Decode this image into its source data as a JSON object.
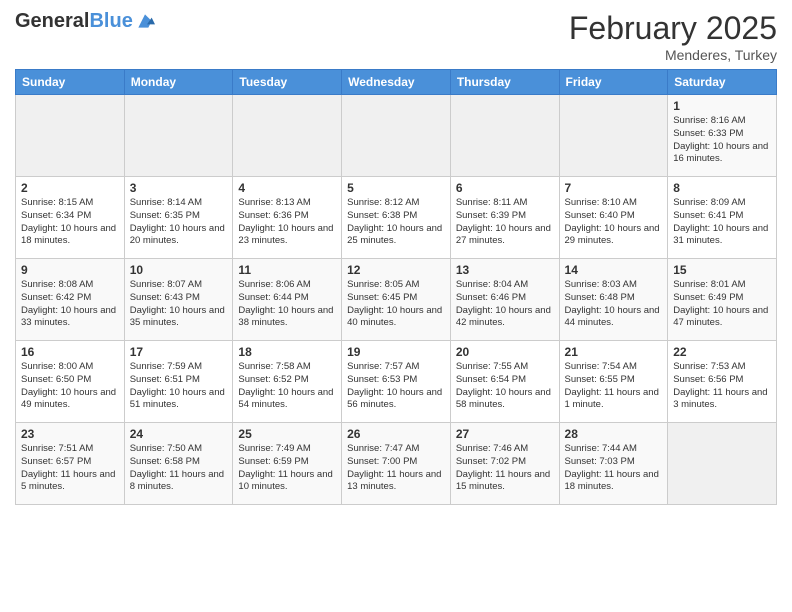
{
  "header": {
    "logo_general": "General",
    "logo_blue": "Blue",
    "month_title": "February 2025",
    "subtitle": "Menderes, Turkey"
  },
  "days_of_week": [
    "Sunday",
    "Monday",
    "Tuesday",
    "Wednesday",
    "Thursday",
    "Friday",
    "Saturday"
  ],
  "weeks": [
    [
      {
        "day": "",
        "info": ""
      },
      {
        "day": "",
        "info": ""
      },
      {
        "day": "",
        "info": ""
      },
      {
        "day": "",
        "info": ""
      },
      {
        "day": "",
        "info": ""
      },
      {
        "day": "",
        "info": ""
      },
      {
        "day": "1",
        "info": "Sunrise: 8:16 AM\nSunset: 6:33 PM\nDaylight: 10 hours and 16 minutes."
      }
    ],
    [
      {
        "day": "2",
        "info": "Sunrise: 8:15 AM\nSunset: 6:34 PM\nDaylight: 10 hours and 18 minutes."
      },
      {
        "day": "3",
        "info": "Sunrise: 8:14 AM\nSunset: 6:35 PM\nDaylight: 10 hours and 20 minutes."
      },
      {
        "day": "4",
        "info": "Sunrise: 8:13 AM\nSunset: 6:36 PM\nDaylight: 10 hours and 23 minutes."
      },
      {
        "day": "5",
        "info": "Sunrise: 8:12 AM\nSunset: 6:38 PM\nDaylight: 10 hours and 25 minutes."
      },
      {
        "day": "6",
        "info": "Sunrise: 8:11 AM\nSunset: 6:39 PM\nDaylight: 10 hours and 27 minutes."
      },
      {
        "day": "7",
        "info": "Sunrise: 8:10 AM\nSunset: 6:40 PM\nDaylight: 10 hours and 29 minutes."
      },
      {
        "day": "8",
        "info": "Sunrise: 8:09 AM\nSunset: 6:41 PM\nDaylight: 10 hours and 31 minutes."
      }
    ],
    [
      {
        "day": "9",
        "info": "Sunrise: 8:08 AM\nSunset: 6:42 PM\nDaylight: 10 hours and 33 minutes."
      },
      {
        "day": "10",
        "info": "Sunrise: 8:07 AM\nSunset: 6:43 PM\nDaylight: 10 hours and 35 minutes."
      },
      {
        "day": "11",
        "info": "Sunrise: 8:06 AM\nSunset: 6:44 PM\nDaylight: 10 hours and 38 minutes."
      },
      {
        "day": "12",
        "info": "Sunrise: 8:05 AM\nSunset: 6:45 PM\nDaylight: 10 hours and 40 minutes."
      },
      {
        "day": "13",
        "info": "Sunrise: 8:04 AM\nSunset: 6:46 PM\nDaylight: 10 hours and 42 minutes."
      },
      {
        "day": "14",
        "info": "Sunrise: 8:03 AM\nSunset: 6:48 PM\nDaylight: 10 hours and 44 minutes."
      },
      {
        "day": "15",
        "info": "Sunrise: 8:01 AM\nSunset: 6:49 PM\nDaylight: 10 hours and 47 minutes."
      }
    ],
    [
      {
        "day": "16",
        "info": "Sunrise: 8:00 AM\nSunset: 6:50 PM\nDaylight: 10 hours and 49 minutes."
      },
      {
        "day": "17",
        "info": "Sunrise: 7:59 AM\nSunset: 6:51 PM\nDaylight: 10 hours and 51 minutes."
      },
      {
        "day": "18",
        "info": "Sunrise: 7:58 AM\nSunset: 6:52 PM\nDaylight: 10 hours and 54 minutes."
      },
      {
        "day": "19",
        "info": "Sunrise: 7:57 AM\nSunset: 6:53 PM\nDaylight: 10 hours and 56 minutes."
      },
      {
        "day": "20",
        "info": "Sunrise: 7:55 AM\nSunset: 6:54 PM\nDaylight: 10 hours and 58 minutes."
      },
      {
        "day": "21",
        "info": "Sunrise: 7:54 AM\nSunset: 6:55 PM\nDaylight: 11 hours and 1 minute."
      },
      {
        "day": "22",
        "info": "Sunrise: 7:53 AM\nSunset: 6:56 PM\nDaylight: 11 hours and 3 minutes."
      }
    ],
    [
      {
        "day": "23",
        "info": "Sunrise: 7:51 AM\nSunset: 6:57 PM\nDaylight: 11 hours and 5 minutes."
      },
      {
        "day": "24",
        "info": "Sunrise: 7:50 AM\nSunset: 6:58 PM\nDaylight: 11 hours and 8 minutes."
      },
      {
        "day": "25",
        "info": "Sunrise: 7:49 AM\nSunset: 6:59 PM\nDaylight: 11 hours and 10 minutes."
      },
      {
        "day": "26",
        "info": "Sunrise: 7:47 AM\nSunset: 7:00 PM\nDaylight: 11 hours and 13 minutes."
      },
      {
        "day": "27",
        "info": "Sunrise: 7:46 AM\nSunset: 7:02 PM\nDaylight: 11 hours and 15 minutes."
      },
      {
        "day": "28",
        "info": "Sunrise: 7:44 AM\nSunset: 7:03 PM\nDaylight: 11 hours and 18 minutes."
      },
      {
        "day": "",
        "info": ""
      }
    ]
  ]
}
